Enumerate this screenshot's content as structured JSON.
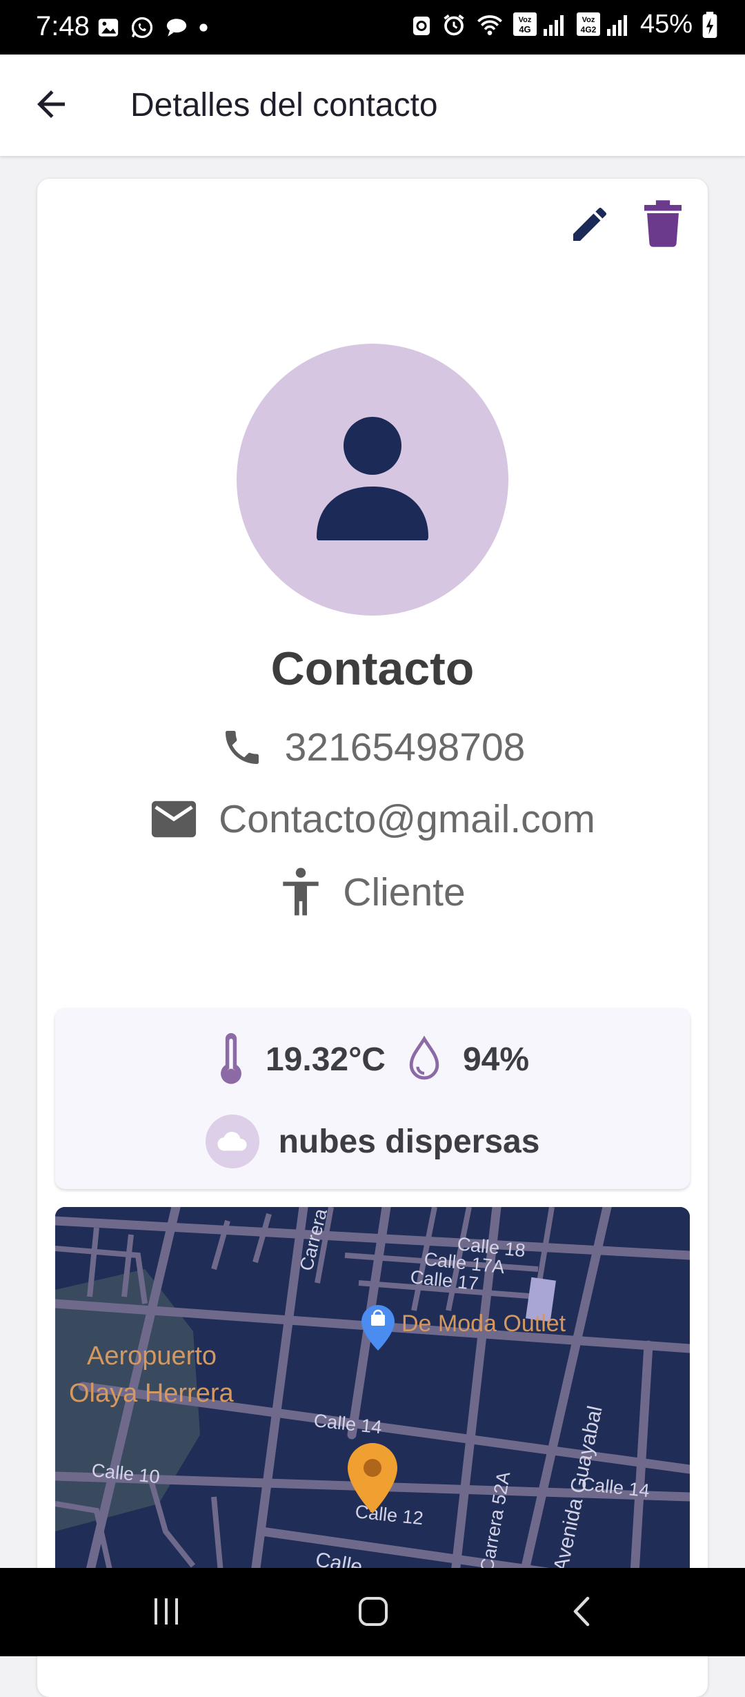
{
  "status_bar": {
    "time": "7:48",
    "battery": "45%",
    "network_labels": [
      "Voz 4G",
      "Voz 4G2"
    ]
  },
  "app_bar": {
    "title": "Detalles del contacto",
    "back_icon": "arrow-back-icon"
  },
  "actions": {
    "edit_icon": "pencil-icon",
    "delete_icon": "trash-icon",
    "edit_color": "#1b2a57",
    "delete_color": "#6b3a8c"
  },
  "contact": {
    "name": "Contacto",
    "phone": "32165498708",
    "email": "Contacto@gmail.com",
    "type": "Cliente",
    "avatar_bg": "#d6c6e1",
    "avatar_fg": "#1b2a57"
  },
  "weather": {
    "temperature": "19.32°C",
    "humidity": "94%",
    "description": "nubes dispersas"
  },
  "map": {
    "labels": {
      "calle18": "Calle 18",
      "calle17a": "Calle 17A",
      "calle17": "Calle 17",
      "carrera": "Carrera",
      "outlet": "De Moda Outlet",
      "airport1": "Aeropuerto",
      "airport2": "Olaya Herrera",
      "calle14": "Calle 14",
      "calle14b": "Calle 14",
      "calle10": "Calle 10",
      "calle12": "Calle 12",
      "carrera52a": "Carrera 52A",
      "guayabal": "Avenida Guayabal",
      "calle_bottom": "Calle"
    }
  },
  "colors": {
    "map_bg": "#1f2d57",
    "map_roads": "#6f6a8c",
    "accent": "#6b3a8c",
    "marker": "#f0a030"
  }
}
